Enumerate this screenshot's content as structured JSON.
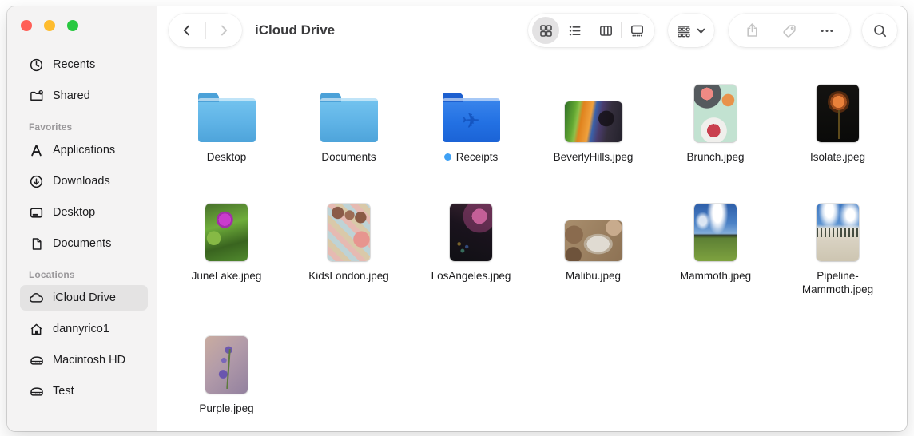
{
  "window": {
    "traffic_lights": {
      "close": "#ff5f57",
      "minimize": "#febc2e",
      "zoom": "#28c840"
    }
  },
  "toolbar": {
    "title": "iCloud Drive",
    "back_icon": "chevron-left",
    "forward_icon": "chevron-right",
    "view_buttons": [
      {
        "name": "icon-view",
        "selected": true
      },
      {
        "name": "list-view",
        "selected": false
      },
      {
        "name": "column-view",
        "selected": false
      },
      {
        "name": "gallery-view",
        "selected": false
      }
    ],
    "group_button": "group-by",
    "share_button": "share",
    "tag_button": "tag",
    "more_button": "more-ellipsis",
    "search_button": "search",
    "disabled_icon_color": "#c5c5c5",
    "enabled_icon_color": "#515154"
  },
  "sidebar": {
    "sections": [
      {
        "header": "",
        "items": [
          {
            "label": "Recents",
            "icon": "clock-icon"
          },
          {
            "label": "Shared",
            "icon": "shared-folder-icon"
          }
        ]
      },
      {
        "header": "Favorites",
        "items": [
          {
            "label": "Applications",
            "icon": "app-store-icon"
          },
          {
            "label": "Downloads",
            "icon": "download-circle-icon"
          },
          {
            "label": "Desktop",
            "icon": "display-icon"
          },
          {
            "label": "Documents",
            "icon": "document-icon"
          }
        ]
      },
      {
        "header": "Locations",
        "items": [
          {
            "label": "iCloud Drive",
            "icon": "cloud-icon",
            "selected": true
          },
          {
            "label": "dannyrico1",
            "icon": "home-icon"
          },
          {
            "label": "Macintosh HD",
            "icon": "hard-drive-icon"
          },
          {
            "label": "Test",
            "icon": "hard-drive-icon"
          }
        ]
      }
    ],
    "selected_item": "iCloud Drive",
    "selection_color": "#e4e3e3"
  },
  "files": [
    {
      "name": "Desktop",
      "kind": "folder"
    },
    {
      "name": "Documents",
      "kind": "folder"
    },
    {
      "name": "Receipts",
      "kind": "folder",
      "folder_color": "blue",
      "glyph": "airplane",
      "badge": "blue-sync-dot",
      "badge_color": "#3fa1f5"
    },
    {
      "name": "BeverlyHills.jpeg",
      "kind": "image",
      "orientation": "landscape"
    },
    {
      "name": "Brunch.jpeg",
      "kind": "image",
      "orientation": "portrait"
    },
    {
      "name": "Isolate.jpeg",
      "kind": "image",
      "orientation": "portrait"
    },
    {
      "name": "JuneLake.jpeg",
      "kind": "image",
      "orientation": "portrait"
    },
    {
      "name": "KidsLondon.jpeg",
      "kind": "image",
      "orientation": "portrait"
    },
    {
      "name": "LosAngeles.jpeg",
      "kind": "image",
      "orientation": "portrait"
    },
    {
      "name": "Malibu.jpeg",
      "kind": "image",
      "orientation": "landscape"
    },
    {
      "name": "Mammoth.jpeg",
      "kind": "image",
      "orientation": "portrait"
    },
    {
      "name": "Pipeline-Mammoth.jpeg",
      "kind": "image",
      "orientation": "portrait"
    },
    {
      "name": "Purple.jpeg",
      "kind": "image",
      "orientation": "portrait"
    }
  ],
  "colors": {
    "folder_blue_light": "#5fb3e6",
    "folder_blue_vivid": "#2371e3",
    "sidebar_bg": "#f4f3f3",
    "content_bg": "#ffffff"
  }
}
